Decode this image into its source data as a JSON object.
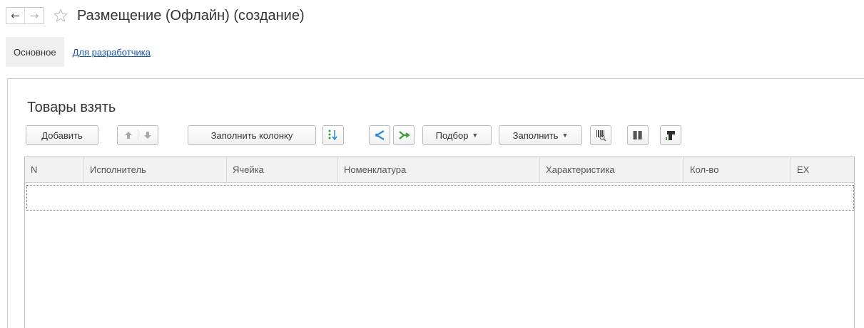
{
  "window": {
    "title": "Размещение (Офлайн) (создание)"
  },
  "nav": {
    "back_icon": "left-arrow-icon",
    "forward_icon": "right-arrow-icon",
    "favorite_icon": "star-icon"
  },
  "tabs": [
    {
      "label": "Основное",
      "active": true
    },
    {
      "label": "Для разработчика",
      "active": false
    }
  ],
  "section": {
    "title": "Товары взять"
  },
  "toolbar": {
    "add_label": "Добавить",
    "fill_column_label": "Заполнить колонку",
    "selection_label": "Подбор",
    "fill_label": "Заполнить",
    "icons": [
      "move-up-icon",
      "move-down-icon",
      "sort-icon",
      "split-icon",
      "merge-icon",
      "barcode-search-icon",
      "barcode-icon",
      "scanner-icon"
    ]
  },
  "table": {
    "columns": [
      "N",
      "Исполнитель",
      "Ячейка",
      "Номенклатура",
      "Характеристика",
      "Кол-во",
      "EX"
    ],
    "rows": []
  },
  "colors": {
    "link": "#1a55b4",
    "active_tab_bg": "#efefef",
    "icon_green": "#3c9a3c",
    "icon_blue": "#2b8ad8"
  }
}
